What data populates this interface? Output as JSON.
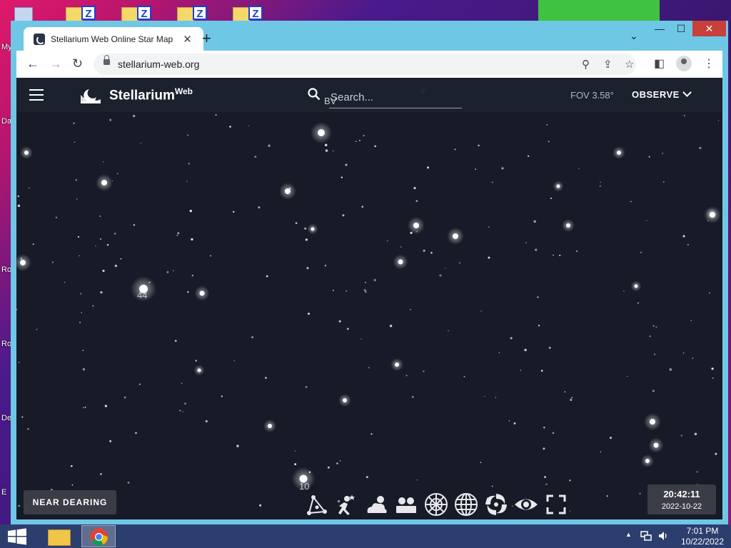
{
  "desktop": {
    "labels": [
      "My",
      "Da",
      "Ro",
      "Ro",
      "De",
      "E"
    ]
  },
  "browser": {
    "tab_title": "Stellarium Web Online Star Map",
    "tab_close": "✕",
    "new_tab": "+",
    "tab_dropdown": "⌄",
    "win_min": "—",
    "win_max": "☐",
    "win_close": "✕",
    "back": "←",
    "forward": "→",
    "reload": "↻",
    "url": "stellarium-web.org",
    "location_icon": "⚲",
    "share_icon": "⇪",
    "bookmark_icon": "☆",
    "sidepanel_icon": "◧",
    "menu_icon": "⋮"
  },
  "app": {
    "brand": "Stellarium",
    "brand_sup": "Web",
    "search_placeholder": "Search...",
    "fov": "FOV 3.58°",
    "observe": "OBSERVE",
    "location": "NEAR DEARING",
    "time": "20:42:11",
    "date": "2022-10-22",
    "star_labels": [
      {
        "text": "44"
      },
      {
        "text": "10"
      },
      {
        "text": "BV"
      }
    ],
    "bottom_buttons": [
      "constellation-lines",
      "constellation-art",
      "atmosphere",
      "landscape",
      "azimuthal-grid",
      "equatorial-grid",
      "deep-sky-objects",
      "night-mode",
      "fullscreen"
    ]
  },
  "taskbar": {
    "time": "7:01 PM",
    "date": "10/22/2022",
    "tray_arrow": "▲"
  },
  "colors": {
    "sky": "#161b27",
    "appbar": "#1c212e",
    "taskbar": "#2c3e6e",
    "window_frame": "#6fc7e6",
    "close_button": "#c8403a"
  }
}
